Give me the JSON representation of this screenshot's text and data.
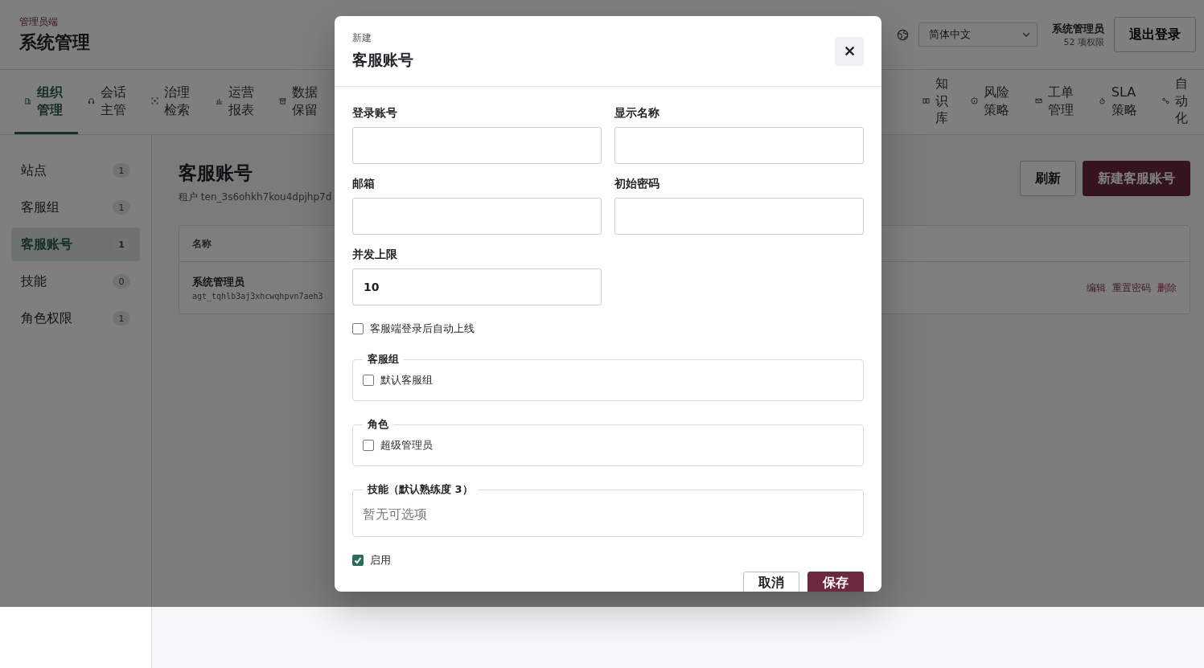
{
  "header": {
    "eyebrow": "管理员端",
    "title": "系统管理",
    "language_select": {
      "value": "简体中文"
    },
    "user": {
      "name": "系统管理员",
      "permissions": "52 项权限"
    },
    "logout_button": "退出登录"
  },
  "nav": {
    "tabs": [
      {
        "label": "组织管理",
        "selected": true
      },
      {
        "label": "会话主管",
        "selected": false
      },
      {
        "label": "治理检索",
        "selected": false
      },
      {
        "label": "运营报表",
        "selected": false
      },
      {
        "label": "数据保留",
        "selected": false
      },
      {
        "label": "知识库",
        "selected": false
      },
      {
        "label": "风险策略",
        "selected": false
      },
      {
        "label": "工单管理",
        "selected": false
      },
      {
        "label": "SLA策略",
        "selected": false
      },
      {
        "label": "自动化",
        "selected": false
      }
    ]
  },
  "sidebar": {
    "items": [
      {
        "label": "站点",
        "count": "1",
        "selected": false
      },
      {
        "label": "客服组",
        "count": "1",
        "selected": false
      },
      {
        "label": "客服账号",
        "count": "1",
        "selected": true
      },
      {
        "label": "技能",
        "count": "0",
        "selected": false
      },
      {
        "label": "角色权限",
        "count": "1",
        "selected": false
      }
    ]
  },
  "main": {
    "title": "客服账号",
    "tenant": "租户 ten_3s6ohkh7kou4dpjhp7d",
    "buttons": [
      {
        "label": "刷新",
        "kind": "secondary"
      },
      {
        "label": "新建客服账号",
        "kind": "primary"
      }
    ],
    "table": {
      "columns": [
        "名称"
      ],
      "rows": [
        {
          "name": "系统管理员",
          "id": "agt_tqhlb3aj3xhcwqhpvn7aeh3",
          "actions": [
            {
              "label": "编辑",
              "kind": "normal"
            },
            {
              "label": "重置密码",
              "kind": "normal"
            },
            {
              "label": "删除",
              "kind": "danger"
            }
          ]
        }
      ]
    }
  },
  "dialog": {
    "eyebrow": "新建",
    "title": "客服账号",
    "fields": [
      {
        "label": "登录账号"
      },
      {
        "label": "显示名称"
      },
      {
        "label": "邮箱"
      },
      {
        "label": "初始密码"
      },
      {
        "label": "并发上限",
        "value": "10"
      }
    ],
    "auto_online": {
      "label": "客服端登录后自动上线",
      "checked": false
    },
    "groups": [
      {
        "legend": "客服组",
        "kind": "checklist",
        "options": [
          {
            "label": "默认客服组",
            "checked": false
          }
        ]
      },
      {
        "legend": "角色",
        "kind": "checklist",
        "options": [
          {
            "label": "超级管理员",
            "checked": false
          }
        ]
      },
      {
        "legend": "技能（默认熟练度 3）",
        "kind": "empty",
        "empty_text": "暂无可选项"
      }
    ],
    "enabled": {
      "label": "启用",
      "checked": true
    },
    "buttons": [
      {
        "label": "取消",
        "kind": "secondary"
      },
      {
        "label": "保存",
        "kind": "primary"
      }
    ]
  }
}
